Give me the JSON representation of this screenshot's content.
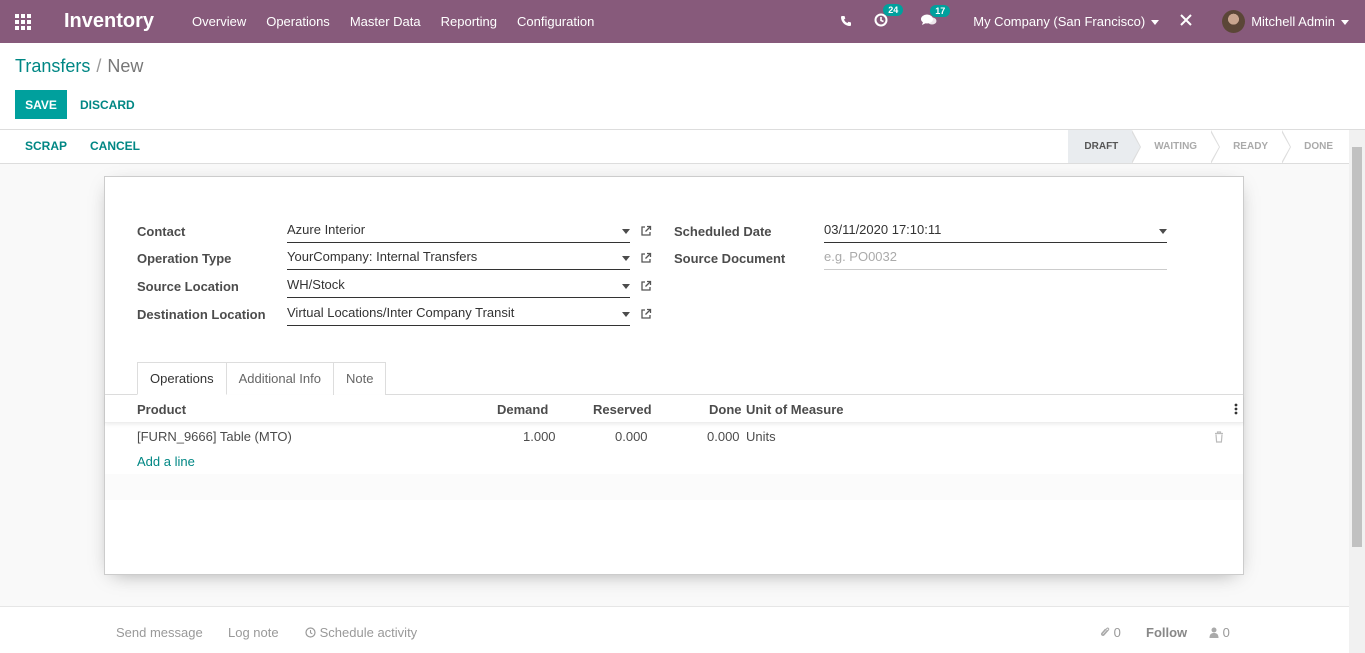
{
  "navbar": {
    "app_title": "Inventory",
    "menu": [
      "Overview",
      "Operations",
      "Master Data",
      "Reporting",
      "Configuration"
    ],
    "activity_count": "24",
    "message_count": "17",
    "company": "My Company (San Francisco)",
    "user": "Mitchell Admin",
    "icons": [
      "apps-grid-icon",
      "phone-icon",
      "clock-icon",
      "chat-icon",
      "debug-icon",
      "avatar"
    ]
  },
  "breadcrumb": {
    "parent": "Transfers",
    "separator": "/",
    "current": "New"
  },
  "buttons": {
    "save": "SAVE",
    "discard": "DISCARD",
    "scrap": "SCRAP",
    "cancel": "CANCEL"
  },
  "stages": [
    "DRAFT",
    "WAITING",
    "READY",
    "DONE"
  ],
  "active_stage": "DRAFT",
  "form": {
    "contact_label": "Contact",
    "contact_value": "Azure Interior",
    "operation_type_label": "Operation Type",
    "operation_type_value": "YourCompany: Internal Transfers",
    "source_location_label": "Source Location",
    "source_location_value": "WH/Stock",
    "destination_location_label": "Destination Location",
    "destination_location_value": "Virtual Locations/Inter Company Transit",
    "scheduled_date_label": "Scheduled Date",
    "scheduled_date_value": "03/11/2020 17:10:11",
    "source_document_label": "Source Document",
    "source_document_placeholder": "e.g. PO0032"
  },
  "tabs": [
    "Operations",
    "Additional Info",
    "Note"
  ],
  "table": {
    "headers": {
      "product": "Product",
      "demand": "Demand",
      "reserved": "Reserved",
      "done": "Done",
      "uom": "Unit of Measure"
    },
    "rows": [
      {
        "product": "[FURN_9666] Table (MTO)",
        "demand": "1.000",
        "reserved": "0.000",
        "done": "0.000",
        "uom": "Units"
      }
    ],
    "add_line": "Add a line"
  },
  "chatter": {
    "send_message": "Send message",
    "log_note": "Log note",
    "schedule_activity": "Schedule activity",
    "attachments": "0",
    "follow": "Follow",
    "followers": "0"
  },
  "colors": {
    "navbar": "#875a7b",
    "primary": "#00a09d",
    "link": "#008784"
  }
}
